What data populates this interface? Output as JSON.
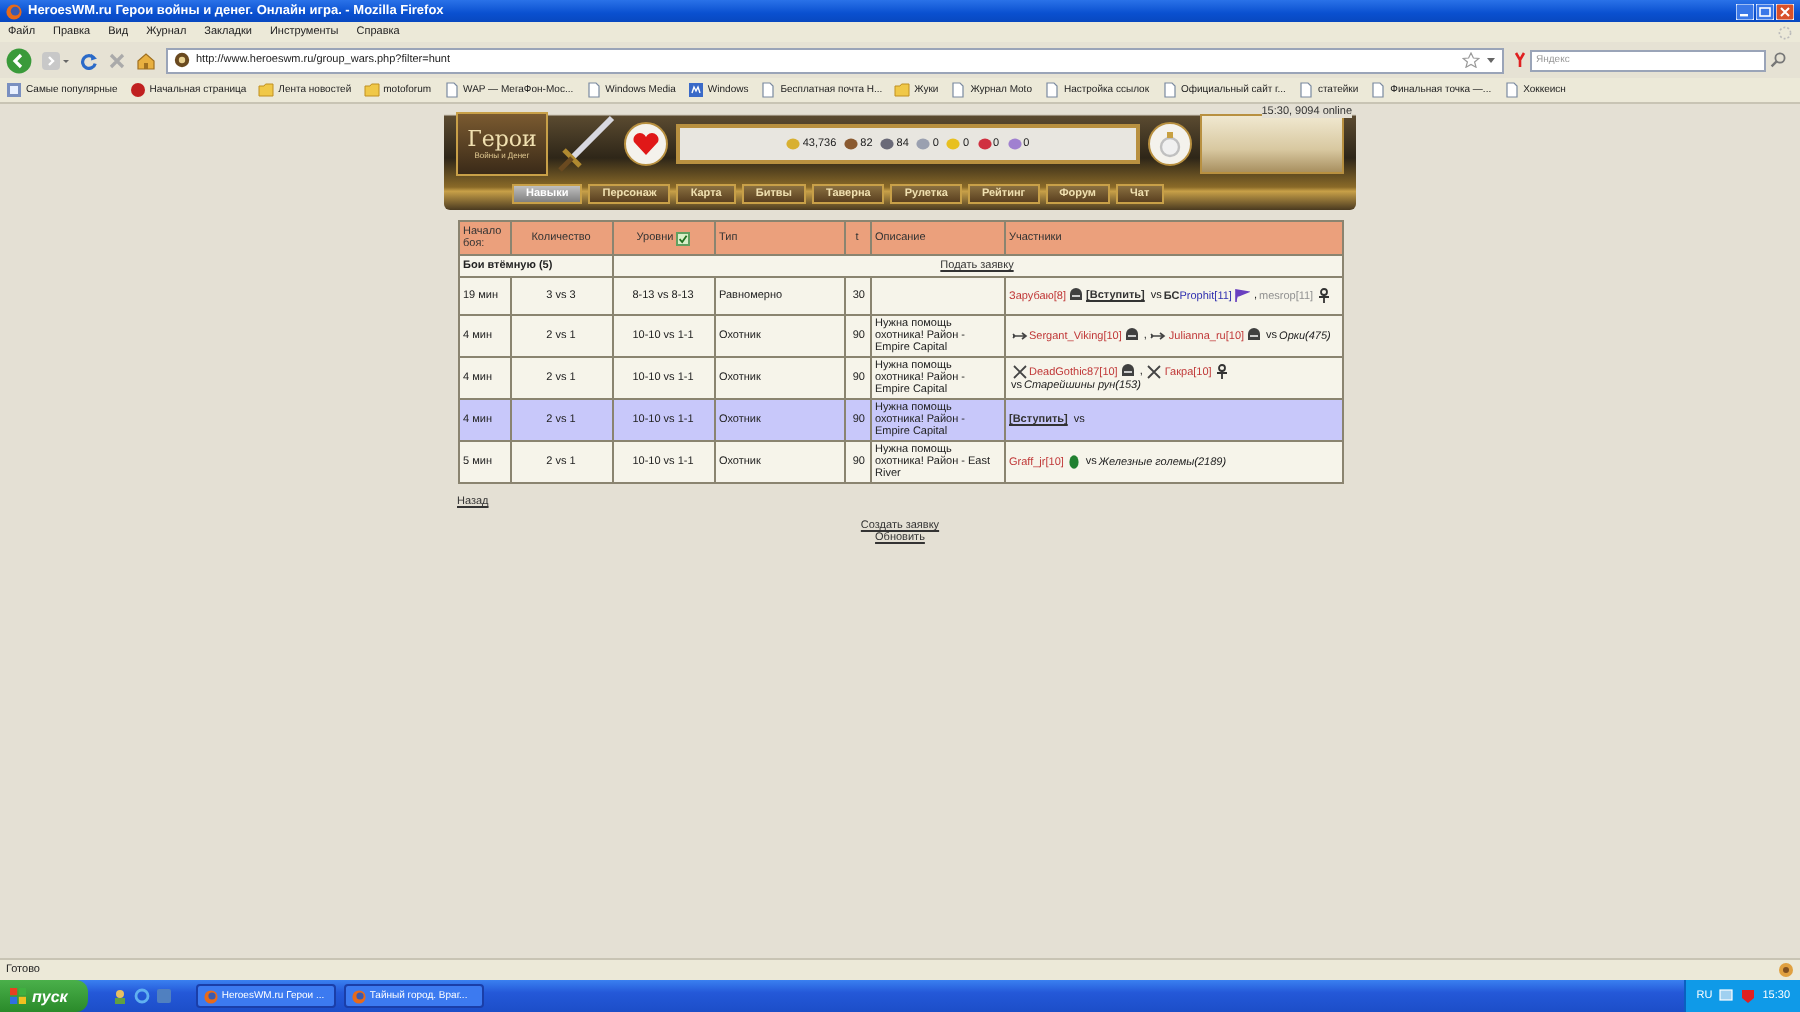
{
  "window": {
    "title": "HeroesWM.ru Герои войны и денег. Онлайн игра. - Mozilla Firefox"
  },
  "menu": [
    "Файл",
    "Правка",
    "Вид",
    "Журнал",
    "Закладки",
    "Инструменты",
    "Справка"
  ],
  "nav": {
    "url": "http://www.heroeswm.ru/group_wars.php?filter=hunt",
    "search_placeholder": "Яндекс"
  },
  "bookmarks": [
    {
      "label": "Самые популярные",
      "kind": "grid"
    },
    {
      "label": "Начальная страница",
      "kind": "blob"
    },
    {
      "label": "Лента новостей",
      "kind": "folder"
    },
    {
      "label": "motoforum",
      "kind": "folder"
    },
    {
      "label": "WAP — МегаФон-Мос...",
      "kind": "page"
    },
    {
      "label": "Windows Media",
      "kind": "page"
    },
    {
      "label": "Windows",
      "kind": "tile"
    },
    {
      "label": "Бесплатная почта H...",
      "kind": "page"
    },
    {
      "label": "Жуки",
      "kind": "folder"
    },
    {
      "label": "Журнал Moto",
      "kind": "page"
    },
    {
      "label": "Настройка ссылок",
      "kind": "page"
    },
    {
      "label": "Официальный сайт г...",
      "kind": "page"
    },
    {
      "label": "статейки",
      "kind": "page"
    },
    {
      "label": "Финальная точка —...",
      "kind": "page"
    },
    {
      "label": "Хоккеисн",
      "kind": "page"
    }
  ],
  "game_header": {
    "logo": "Герои",
    "logo_subtitle": "Войны и Денег",
    "time_online": "15:30, 9094 online",
    "resources": [
      {
        "value": "43,736",
        "color": "#d8b030"
      },
      {
        "value": "82",
        "color": "#8a5a30"
      },
      {
        "value": "84",
        "color": "#6a6a78"
      },
      {
        "value": "0",
        "color": "#9aa0b0"
      },
      {
        "value": "0",
        "color": "#e8c020"
      },
      {
        "value": "0",
        "color": "#d03040"
      },
      {
        "value": "0",
        "color": "#a080d0"
      }
    ],
    "tabs": [
      {
        "label": "Навыки",
        "selected": true
      },
      {
        "label": "Персонаж",
        "selected": false
      },
      {
        "label": "Карта",
        "selected": false
      },
      {
        "label": "Битвы",
        "selected": false
      },
      {
        "label": "Таверна",
        "selected": false
      },
      {
        "label": "Рулетка",
        "selected": false
      },
      {
        "label": "Рейтинг",
        "selected": false
      },
      {
        "label": "Форум",
        "selected": false
      },
      {
        "label": "Чат",
        "selected": false
      }
    ]
  },
  "table": {
    "columns": [
      "Начало боя:",
      "Количество",
      "Уровни",
      "Тип",
      "t",
      "Описание",
      "Участники"
    ],
    "levels_filter_checked": true,
    "group": {
      "title": "Бои втёмную (5)",
      "link": "Подать заявку"
    },
    "rows": [
      {
        "start": "19 мин",
        "count": "3 vs 3",
        "levels": "8-13 vs 8-13",
        "type": "Равномерно",
        "t": "30",
        "highlighted": false,
        "participants": [
          {
            "kind": "player",
            "text": "Зарубаю[8]",
            "color": "#c03838"
          },
          {
            "kind": "helmet"
          },
          {
            "kind": "join",
            "text": "[Вступить]"
          },
          {
            "kind": "text",
            "text": "vs"
          },
          {
            "kind": "clan",
            "text": "БС"
          },
          {
            "kind": "player",
            "text": "Prophit[11]",
            "color": "#3030b0"
          },
          {
            "kind": "flag"
          },
          {
            "kind": "text",
            "text": ","
          },
          {
            "kind": "player",
            "text": "mesrop[11]",
            "color": "#909090"
          },
          {
            "kind": "ankh"
          }
        ]
      },
      {
        "start": "4 мин",
        "count": "2 vs 1",
        "levels": "10-10 vs 1-1",
        "type": "Охотник",
        "t": "90",
        "description": "Нужна помощь охотника! Район - Empire Capital",
        "highlighted": false,
        "participants": [
          {
            "kind": "arrow"
          },
          {
            "kind": "player",
            "text": "Sergant_Viking[10]",
            "color": "#c03838"
          },
          {
            "kind": "helmet"
          },
          {
            "kind": "text",
            "text": ","
          },
          {
            "kind": "arrow"
          },
          {
            "kind": "player",
            "text": "Julianna_ru[10]",
            "color": "#c03838"
          },
          {
            "kind": "helmet"
          },
          {
            "kind": "text",
            "text": "vs"
          },
          {
            "kind": "monster",
            "text": "Орки(475)"
          }
        ]
      },
      {
        "start": "4 мин",
        "count": "2 vs 1",
        "levels": "10-10 vs 1-1",
        "type": "Охотник",
        "t": "90",
        "description": "Нужна помощь охотника! Район - Empire Capital",
        "highlighted": false,
        "participants": [
          {
            "kind": "swords"
          },
          {
            "kind": "player",
            "text": "DeadGothic87[10]",
            "color": "#c03838"
          },
          {
            "kind": "helmet"
          },
          {
            "kind": "text",
            "text": ","
          },
          {
            "kind": "swords"
          },
          {
            "kind": "player",
            "text": "Гакра[10]",
            "color": "#c03838"
          },
          {
            "kind": "ankh"
          },
          {
            "kind": "text",
            "text": "vs"
          },
          {
            "kind": "monster",
            "text": "Старейшины рун(153)"
          }
        ]
      },
      {
        "start": "4 мин",
        "count": "2 vs 1",
        "levels": "10-10 vs 1-1",
        "type": "Охотник",
        "t": "90",
        "description": "Нужна помощь охотника! Район - Empire Capital",
        "highlighted": true,
        "participants": [
          {
            "kind": "join",
            "text": "[Вступить]"
          },
          {
            "kind": "text",
            "text": "vs"
          }
        ]
      },
      {
        "start": "5 мин",
        "count": "2 vs 1",
        "levels": "10-10 vs 1-1",
        "type": "Охотник",
        "t": "90",
        "description": "Нужна помощь охотника! Район - East River",
        "highlighted": false,
        "participants": [
          {
            "kind": "player",
            "text": "Graff_jr[10]",
            "color": "#c03838"
          },
          {
            "kind": "leaf"
          },
          {
            "kind": "text",
            "text": "vs"
          },
          {
            "kind": "monster",
            "text": "Железные големы(2189)"
          }
        ]
      }
    ]
  },
  "back_link": "Назад",
  "bottom_links": [
    "Создать заявку",
    "Обновить"
  ],
  "status_bar": {
    "text": "Готово"
  },
  "taskbar": {
    "start": "пуск",
    "tasks": [
      "HeroesWM.ru Герои ...",
      "Тайный город. Враг..."
    ],
    "language": "RU",
    "clock": "15:30"
  }
}
